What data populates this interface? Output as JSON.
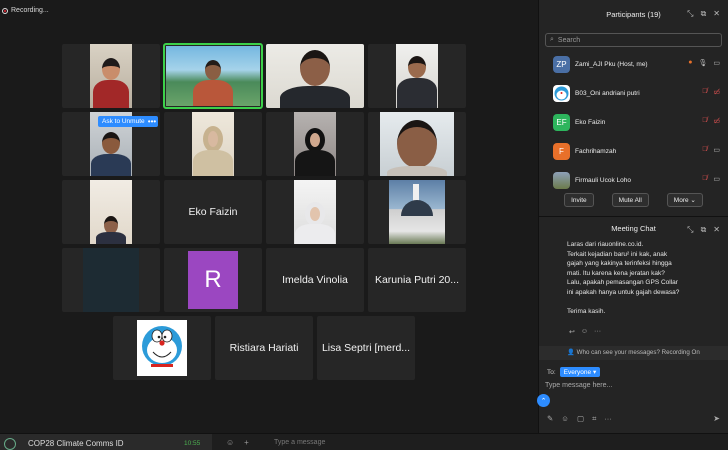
{
  "recording": {
    "label": "Recording..."
  },
  "gallery": {
    "ask_unmute": "Ask to Unmute",
    "more_dots": "•••",
    "tiles": {
      "eko": "Eko Faizin",
      "r_initial": "R",
      "imelda": "Imelda Vinolia",
      "karunia": "Karunia Putri 20...",
      "ristiara": "Ristiara Hariati",
      "lisa": "Lisa Septri [merd..."
    }
  },
  "participants": {
    "title": "Participants (19)",
    "search_placeholder": "Search",
    "list": [
      {
        "initials": "ZP",
        "name": "Zami_AJI Pku (Host, me)",
        "color": "#4a6fa5"
      },
      {
        "initials": "",
        "name": "B03_Oni andriani putri",
        "color": "#ffffff"
      },
      {
        "initials": "EF",
        "name": "Eko Faizin",
        "color": "#2db55d"
      },
      {
        "initials": "F",
        "name": "Fachrihamzah",
        "color": "#e8702a"
      },
      {
        "initials": "",
        "name": "Firmauli Ucok Loho",
        "color": "#6b7a4a"
      }
    ],
    "buttons": {
      "invite": "Invite",
      "mute_all": "Mute All",
      "more": "More"
    }
  },
  "chat": {
    "title": "Meeting Chat",
    "message": [
      "Laras dari riauonline.co.id.",
      "Terkait kejadian baru² ini kak, anak",
      "gajah yang kakinya terinfeksi hingga",
      "mati. Itu karena kena jeratan kak?",
      "Lalu, apakah pemasangan GPS Collar",
      "ini apakah hanya untuk gajah dewasa?",
      "",
      "Terima kasih."
    ],
    "who_can_see": "Who can see your messages? Recording On",
    "to_label": "To:",
    "to_value": "Everyone",
    "placeholder": "Type message here..."
  },
  "bottom": {
    "title": "COP28 Climate Comms ID",
    "time": "10:55",
    "type_message": "Type a message"
  },
  "colors": {
    "accent": "#2d8cff",
    "active_speaker": "#3cd14a",
    "muted": "#e55555",
    "avatar_r": "#9b47c1"
  }
}
